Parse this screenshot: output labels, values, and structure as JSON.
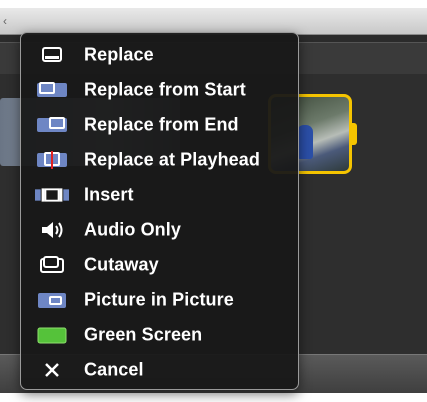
{
  "menu": {
    "items": [
      {
        "label": "Replace",
        "icon": "replace-icon"
      },
      {
        "label": "Replace from Start",
        "icon": "replace-from-start-icon"
      },
      {
        "label": "Replace from End",
        "icon": "replace-from-end-icon"
      },
      {
        "label": "Replace at Playhead",
        "icon": "replace-at-playhead-icon"
      },
      {
        "label": "Insert",
        "icon": "insert-icon"
      },
      {
        "label": "Audio Only",
        "icon": "speaker-icon"
      },
      {
        "label": "Cutaway",
        "icon": "cutaway-icon"
      },
      {
        "label": "Picture in Picture",
        "icon": "picture-in-picture-icon"
      },
      {
        "label": "Green Screen",
        "icon": "green-screen-icon"
      },
      {
        "label": "Cancel",
        "icon": "close-icon"
      }
    ]
  },
  "colors": {
    "menu_background": "#181818",
    "menu_border": "#9a9a9a",
    "icon_blue": "#6e86c4",
    "green_screen": "#55c23a",
    "selection_yellow": "#f5c400"
  }
}
